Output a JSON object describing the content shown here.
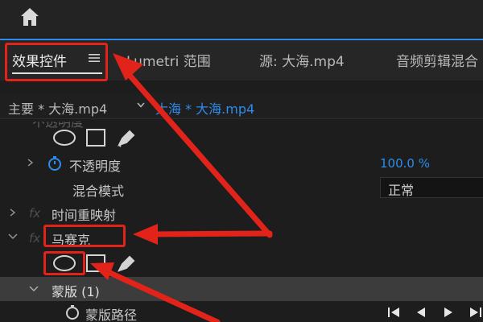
{
  "header": {
    "home_icon": "home-icon"
  },
  "tabs": [
    {
      "label": "效果控件",
      "active": true
    },
    {
      "label": "Lumetri 范围"
    },
    {
      "label": "源: 大海.mp4"
    },
    {
      "label": "音频剪辑混合"
    }
  ],
  "tab_menu_icon": "hamburger-icon",
  "sequence": {
    "master": "主要 * 大海.mp4",
    "current": "大海 * 大海.mp4"
  },
  "rows": {
    "partial": "不透明度",
    "opacity": {
      "label": "不透明度",
      "value": "100.0 %"
    },
    "blend": {
      "label": "混合模式",
      "value": "正常"
    },
    "fx_label": "fx",
    "time_remap": "时间重映射",
    "mosaic": "马赛克",
    "mask": "蒙版 (1)",
    "mask_path": "蒙版路径"
  },
  "colors": {
    "accent": "#2d8ceb",
    "annotation": "#e2231a",
    "panel_bg": "#1d1d1d"
  }
}
